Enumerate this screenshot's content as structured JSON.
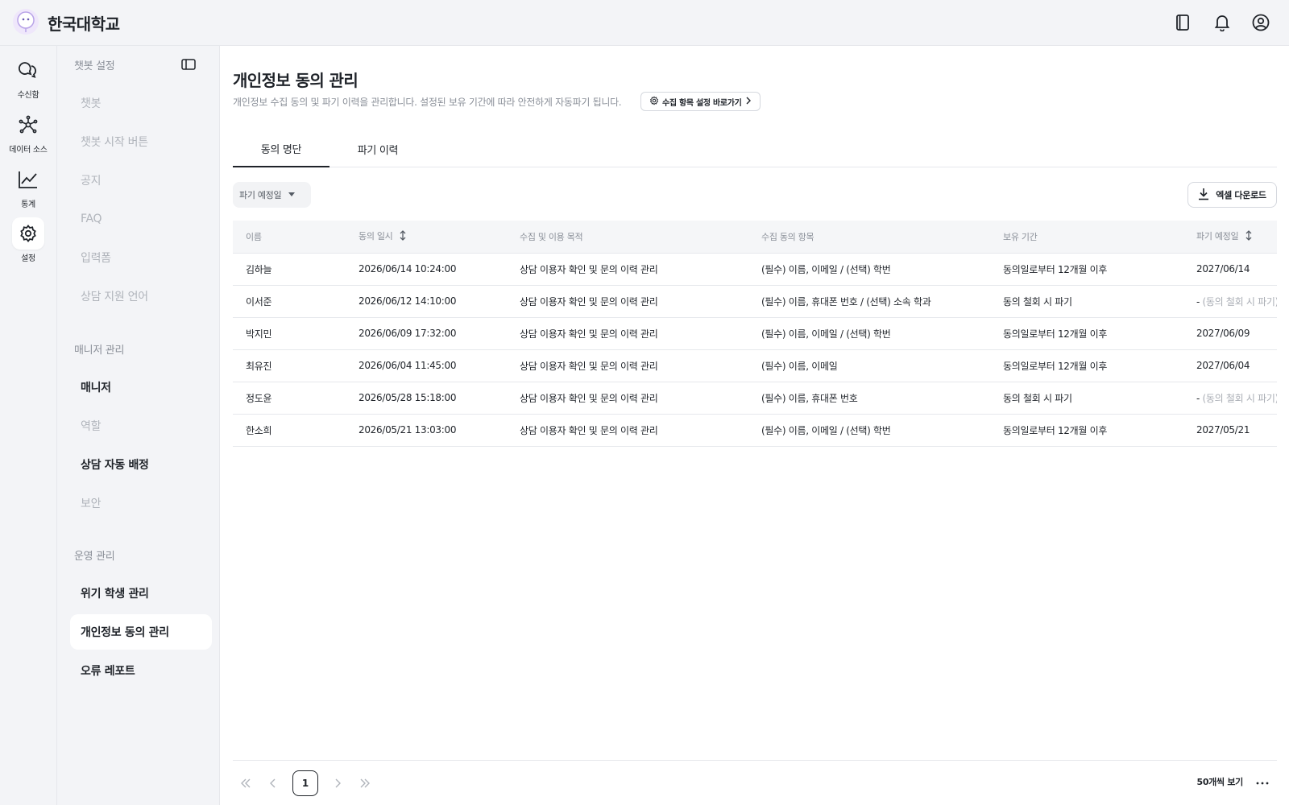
{
  "header": {
    "brand": "한국대학교",
    "icons": [
      "logo-icon",
      "book-icon",
      "bell-icon",
      "user-circle-icon"
    ]
  },
  "rail": {
    "items": [
      {
        "label": "수신함",
        "icon": "chat-bubbles-icon"
      },
      {
        "label": "데이터 소스",
        "icon": "network-icon"
      },
      {
        "label": "통계",
        "icon": "line-chart-icon"
      },
      {
        "label": "설정",
        "icon": "gear-icon",
        "active": true
      }
    ]
  },
  "sidebar": {
    "section_chatbot": "챗봇 설정",
    "chatbot_items": [
      "챗봇",
      "챗봇 시작 버튼",
      "공지",
      "FAQ",
      "입력폼",
      "상담 지원 언어"
    ],
    "section_manager": "매니저 관리",
    "manager_items": [
      "매니저",
      "역할",
      "상담 자동 배정",
      "보안"
    ],
    "section_ops": "운영 관리",
    "ops_items": [
      "위기 학생 관리",
      "개인정보 동의 관리",
      "오류 레포트"
    ]
  },
  "page": {
    "title": "개인정보 동의 관리",
    "description": "개인정보 수집 동의 및 파기 이력을 관리합니다. 설정된 보유 기간에 따라 안전하게 자동파기 됩니다.",
    "shortcut_label": "수집 항목 설정 바로가기"
  },
  "tabs": [
    "동의 명단",
    "파기 이력"
  ],
  "filter": {
    "label": "파기 예정일"
  },
  "excel_label": "엑셀 다운로드",
  "table": {
    "columns": [
      "이름",
      "동의 일시",
      "수집 및 이용 목적",
      "수집 동의 항목",
      "보유 기간",
      "파기 예정일"
    ],
    "rows": [
      {
        "name": "김하늘",
        "date": "2026/06/14 10:24:00",
        "purpose": "상담 이용자 확인 및 문의 이력 관리",
        "items": "(필수) 이름, 이메일 / (선택) 학번",
        "retention": "동의일로부터 12개월 이후",
        "destroy": "2027/06/14",
        "note": ""
      },
      {
        "name": "이서준",
        "date": "2026/06/12 14:10:00",
        "purpose": "상담 이용자 확인 및 문의 이력 관리",
        "items": "(필수) 이름, 휴대폰 번호 / (선택) 소속 학과",
        "retention": "동의 철회 시 파기",
        "destroy": "-",
        "note": "(동의 철회 시 파기)"
      },
      {
        "name": "박지민",
        "date": "2026/06/09 17:32:00",
        "purpose": "상담 이용자 확인 및 문의 이력 관리",
        "items": "(필수) 이름, 이메일 / (선택) 학번",
        "retention": "동의일로부터 12개월 이후",
        "destroy": "2027/06/09",
        "note": ""
      },
      {
        "name": "최유진",
        "date": "2026/06/04 11:45:00",
        "purpose": "상담 이용자 확인 및 문의 이력 관리",
        "items": "(필수) 이름, 이메일",
        "retention": "동의일로부터 12개월 이후",
        "destroy": "2027/06/04",
        "note": ""
      },
      {
        "name": "정도윤",
        "date": "2026/05/28 15:18:00",
        "purpose": "상담 이용자 확인 및 문의 이력 관리",
        "items": "(필수) 이름, 휴대폰 번호",
        "retention": "동의 철회 시 파기",
        "destroy": "-",
        "note": "(동의 철회 시 파기)"
      },
      {
        "name": "한소희",
        "date": "2026/05/21 13:03:00",
        "purpose": "상담 이용자 확인 및 문의 이력 관리",
        "items": "(필수) 이름, 이메일 / (선택) 학번",
        "retention": "동의일로부터 12개월 이후",
        "destroy": "2027/05/21",
        "note": ""
      }
    ]
  },
  "pagination": {
    "current": "1",
    "page_size_label": "50개씩 보기"
  },
  "colors": {
    "bg_side": "#f3f4f7",
    "border": "#e6e8ec",
    "text": "#1f2329",
    "muted": "#8a8f98"
  }
}
